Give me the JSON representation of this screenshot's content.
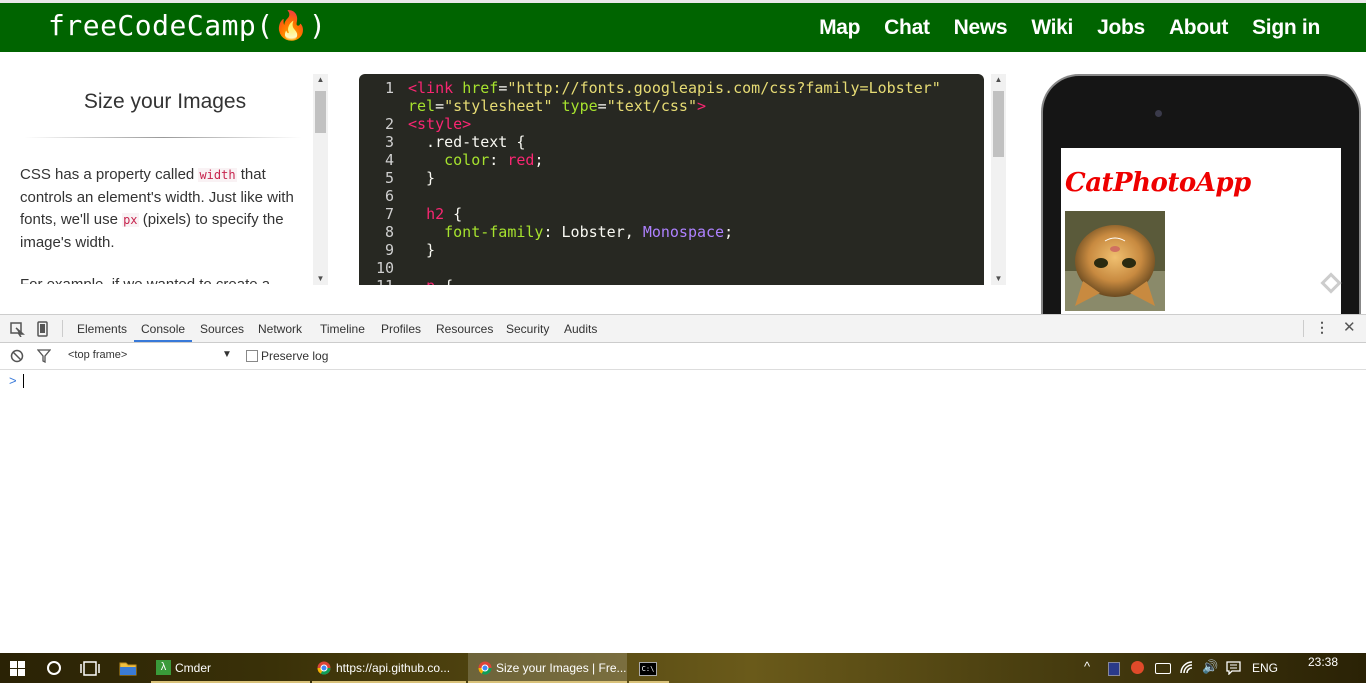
{
  "nav": {
    "brand": "freeCodeCamp(🔥)",
    "links": [
      "Map",
      "Chat",
      "News",
      "Wiki",
      "Jobs",
      "About",
      "Sign in"
    ]
  },
  "challenge": {
    "title": "Size your Images",
    "p1_a": "CSS has a property called ",
    "p1_code1": "width",
    "p1_b": " that controls an element's width. Just like with fonts, we'll use ",
    "p1_code2": "px",
    "p1_c": " (pixels) to specify the image's width.",
    "p2_partial": "For example, if we wanted to create a"
  },
  "editor": {
    "line_numbers": [
      "1",
      "",
      "2",
      "3",
      "4",
      "5",
      "6",
      "7",
      "8",
      "9",
      "10",
      "11"
    ]
  },
  "preview": {
    "heading": "CatPhotoApp",
    "image_alt": "cat photo"
  },
  "devtools": {
    "tabs": [
      "Elements",
      "Console",
      "Sources",
      "Network",
      "Timeline",
      "Profiles",
      "Resources",
      "Security",
      "Audits"
    ],
    "active_tab": "Console",
    "context": "<top frame>",
    "preserve_log": "Preserve log",
    "prompt": ">"
  },
  "taskbar": {
    "apps": [
      {
        "label": "Cmder",
        "icon": "cmder-lambda-icon"
      },
      {
        "label": "https://api.github.co...",
        "icon": "chrome-icon"
      },
      {
        "label": "Size your Images | Fre...",
        "icon": "chrome-icon"
      },
      {
        "label": "",
        "icon": "cmd-icon"
      }
    ],
    "language": "ENG",
    "time": "23:38"
  },
  "colors": {
    "nav_bg": "#006400",
    "editor_bg": "#272822",
    "heading_red": "#e00000",
    "devtools_accent": "#3879d9"
  }
}
